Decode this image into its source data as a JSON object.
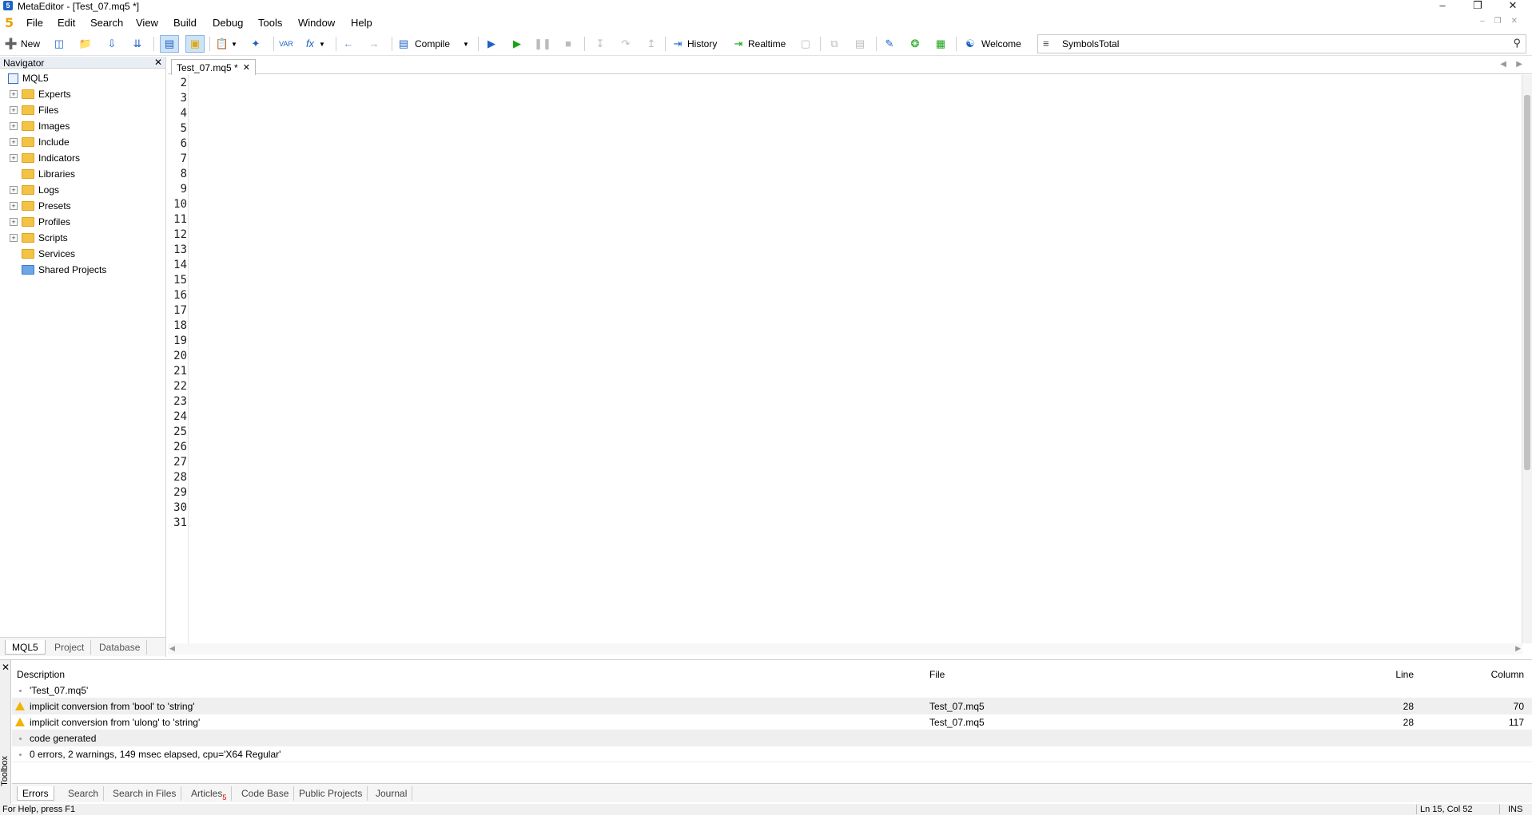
{
  "window": {
    "title": "MetaEditor - [Test_07.mq5 *]",
    "app_logo": "5"
  },
  "menu": [
    "File",
    "Edit",
    "Search",
    "View",
    "Build",
    "Debug",
    "Tools",
    "Window",
    "Help"
  ],
  "toolbar": {
    "new_label": "New",
    "compile_label": "Compile",
    "history_label": "History",
    "realtime_label": "Realtime",
    "welcome_label": "Welcome",
    "search_value": "SymbolsTotal"
  },
  "navigator": {
    "title": "Navigator",
    "root": "MQL5",
    "items": [
      {
        "label": "Experts",
        "expandable": true
      },
      {
        "label": "Files",
        "expandable": true
      },
      {
        "label": "Images",
        "expandable": true
      },
      {
        "label": "Include",
        "expandable": true
      },
      {
        "label": "Indicators",
        "expandable": true
      },
      {
        "label": "Libraries",
        "expandable": false
      },
      {
        "label": "Logs",
        "expandable": true
      },
      {
        "label": "Presets",
        "expandable": true
      },
      {
        "label": "Profiles",
        "expandable": true
      },
      {
        "label": "Scripts",
        "expandable": true
      },
      {
        "label": "Services",
        "expandable": false
      },
      {
        "label": "Shared Projects",
        "expandable": false
      }
    ],
    "tabs": [
      "MQL5",
      "Project",
      "Database"
    ]
  },
  "editor": {
    "tab_label": "Test_07.mq5 *",
    "line_numbers": [
      "2",
      "3",
      "4",
      "5",
      "6",
      "7",
      "8",
      "9",
      "10",
      "11",
      "12",
      "13",
      "14",
      "15",
      "16",
      "17",
      "18",
      "19",
      "20",
      "21",
      "22",
      "23",
      "24",
      "25",
      "26",
      "27",
      "28",
      "29",
      "30",
      "31"
    ]
  },
  "toolbox": {
    "side_label": "Toolbox",
    "columns": {
      "description": "Description",
      "file": "File",
      "line": "Line",
      "column": "Column"
    },
    "rows": [
      {
        "type": "info",
        "description": "'Test_07.mq5'",
        "file": "",
        "line": "",
        "column": ""
      },
      {
        "type": "warning",
        "description": "implicit conversion from 'bool' to 'string'",
        "file": "Test_07.mq5",
        "line": "28",
        "column": "70"
      },
      {
        "type": "warning",
        "description": "implicit conversion from 'ulong' to 'string'",
        "file": "Test_07.mq5",
        "line": "28",
        "column": "117"
      },
      {
        "type": "info",
        "description": "code generated",
        "file": "",
        "line": "",
        "column": ""
      },
      {
        "type": "info",
        "description": "0 errors, 2 warnings, 149 msec elapsed, cpu='X64 Regular'",
        "file": "",
        "line": "",
        "column": ""
      }
    ],
    "tabs": [
      "Errors",
      "Search",
      "Search in Files",
      "Articles",
      "Code Base",
      "Public Projects",
      "Journal"
    ],
    "articles_badge": "5"
  },
  "status": {
    "help": "For Help, press F1",
    "position": "Ln 15, Col 52",
    "mode": "INS"
  }
}
